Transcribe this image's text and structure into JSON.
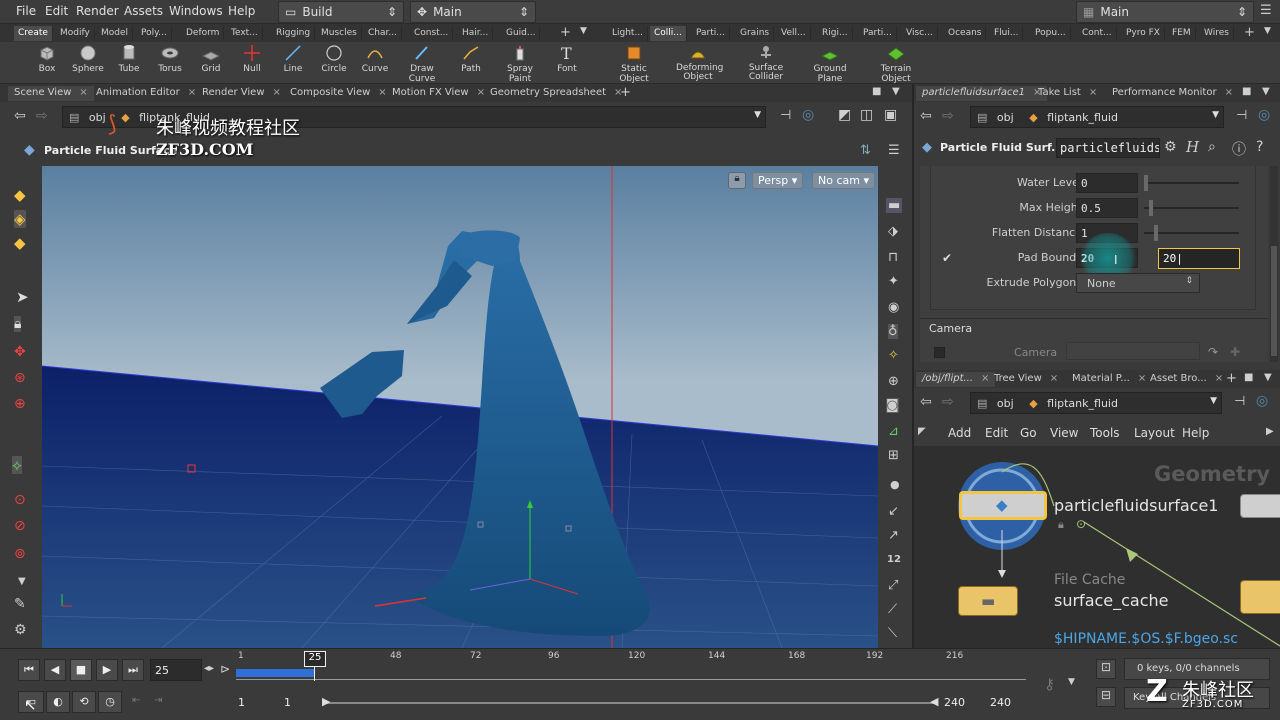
{
  "menubar": {
    "items": [
      "File",
      "Edit",
      "Render",
      "Assets",
      "Windows",
      "Help"
    ],
    "desktop_left": "Build",
    "desktop_mid": "Main",
    "desktop_right": "Main"
  },
  "shelf_tabs_left": [
    "Create",
    "Modify",
    "Model",
    "Poly...",
    "Deform",
    "Text...",
    "Rigging",
    "Muscles",
    "Char...",
    "Const...",
    "Hair...",
    "Guid..."
  ],
  "shelf_tabs_right": [
    "Light...",
    "Colli...",
    "Parti...",
    "Grains",
    "Vell...",
    "Rigi...",
    "Parti...",
    "Visc...",
    "Oceans",
    "Flui...",
    "Popu...",
    "Cont...",
    "Pyro FX",
    "FEM",
    "Wires"
  ],
  "shelf_tools_left": [
    "Box",
    "Sphere",
    "Tube",
    "Torus",
    "Grid",
    "Null",
    "Line",
    "Circle",
    "Curve",
    "Draw Curve",
    "Path",
    "Spray Paint",
    "Font"
  ],
  "shelf_tools_right": [
    "Static Object",
    "Deforming Object",
    "Surface Collider",
    "Ground Plane",
    "Terrain Object"
  ],
  "pane_tabs_left": [
    "Scene View",
    "Animation Editor",
    "Render View",
    "Composite View",
    "Motion FX View",
    "Geometry Spreadsheet"
  ],
  "pane_tabs_right_top": [
    "particlefluidsurface1",
    "Take List",
    "Performance Monitor"
  ],
  "pane_tabs_right_bottom": [
    "/obj/flipt...",
    "Tree View",
    "Material P...",
    "Asset Bro..."
  ],
  "path": {
    "obj": "obj",
    "node": "fliptank_fluid"
  },
  "viewport": {
    "title": "Particle Fluid Surface",
    "persp": "Persp",
    "cam": "No cam"
  },
  "params": {
    "node_title": "Particle Fluid Surf...",
    "node_name": "particlefluids",
    "rows": [
      {
        "label": "Water Level",
        "value": "0",
        "slider": 0.0
      },
      {
        "label": "Max Height",
        "value": "0.5",
        "slider": 0.05
      },
      {
        "label": "Flatten Distance",
        "value": "1",
        "slider": 0.1
      },
      {
        "label": "Pad Bounds",
        "value": "20",
        "value2": "20"
      },
      {
        "label": "Extrude Polygons",
        "value": "None"
      }
    ],
    "section_camera": "Camera",
    "camera_label": "Camera"
  },
  "network": {
    "menu": [
      "Add",
      "Edit",
      "Go",
      "View",
      "Tools",
      "Layout",
      "Help"
    ],
    "context_label": "Geometry",
    "node1": "particlefluidsurface1",
    "node2_type": "File Cache",
    "node2": "surface_cache",
    "node2_file": "$HIPNAME.$OS.$F.bgeo.sc"
  },
  "timeline": {
    "frame": "25",
    "marker": "25",
    "ticks": [
      "1",
      "48",
      "72",
      "96",
      "120",
      "144",
      "168",
      "192",
      "216"
    ],
    "start": "1",
    "start2": "1",
    "end": "240",
    "end2": "240",
    "keys": "0 keys, 0/0 channels",
    "key_all": "Key All Channels"
  },
  "watermark": {
    "cn_top": "朱峰视频教程社区",
    "site_top": "ZF3D.COM",
    "cn_bottom": "朱峰社区",
    "site_bottom": "ZF3D.COM"
  },
  "colors": {
    "accent": "#f5c542",
    "fluid": "#1e5a8a",
    "ground": "#0f2a6a",
    "sky_top": "#5a7fa0",
    "sky_bottom": "#a9bccb"
  }
}
